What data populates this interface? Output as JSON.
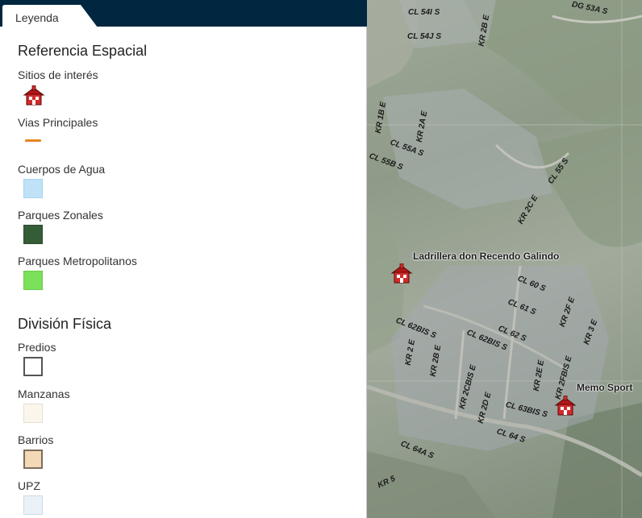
{
  "legend": {
    "tab_label": "Leyenda",
    "sections": [
      {
        "title": "Referencia Espacial",
        "items": [
          {
            "label": "Sitios de interés",
            "symbol": "school-icon"
          },
          {
            "label": "Vias Principales",
            "symbol": "line",
            "color": "#e8841e"
          },
          {
            "label": "Cuerpos de Agua",
            "symbol": "fill",
            "fill": "#bfe2f8",
            "border": "#aad3f0"
          },
          {
            "label": "Parques Zonales",
            "symbol": "fill",
            "fill": "#345c36",
            "border": "#2b4b2d"
          },
          {
            "label": "Parques Metropolitanos",
            "symbol": "fill",
            "fill": "#7be05a",
            "border": "#6acb4c"
          }
        ]
      },
      {
        "title": "División Física",
        "items": [
          {
            "label": "Predios",
            "symbol": "fill",
            "fill": "#ffffff",
            "border": "#555555"
          },
          {
            "label": "Manzanas",
            "symbol": "fill",
            "fill": "#fbf6ec",
            "border": "#e6dfd2"
          },
          {
            "label": "Barrios",
            "symbol": "fill",
            "fill": "#f3d9b5",
            "border": "#7d6d5c"
          },
          {
            "label": "UPZ",
            "symbol": "fill",
            "fill": "#eaf1f7",
            "border": "#cfd9e2"
          }
        ]
      }
    ]
  },
  "map": {
    "road_labels": [
      "CL 54I S",
      "KR 2B E",
      "DG 53A S",
      "CL 54J S",
      "KR 1B E",
      "KR 2A E",
      "CL 55A S",
      "CL 55B S",
      "CL 55 S",
      "KR 2C E",
      "CL 60 S",
      "CL 61 S",
      "KR 2F E",
      "KR 3 E",
      "CL 62BIS S",
      "CL 62 S",
      "CL 62BIS S",
      "KR 2 E",
      "KR 2B E",
      "KR 2CBIS E",
      "KR 2E E",
      "KR 2FBIS E",
      "KR 2D E",
      "CL 63BIS S",
      "CL 64 S",
      "CL 64A S",
      "KR 5"
    ],
    "points_of_interest": [
      {
        "label": "Ladrillera don Recendo Galindo",
        "icon": "school-icon"
      },
      {
        "label": "Memo Sport",
        "icon": "school-icon"
      }
    ]
  }
}
